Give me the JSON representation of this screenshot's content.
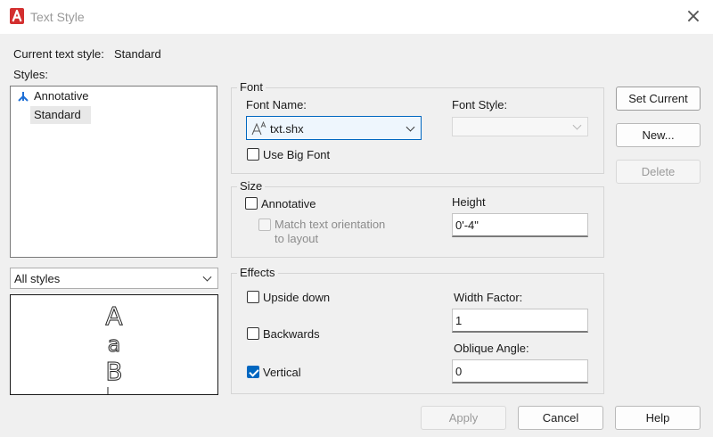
{
  "window": {
    "title": "Text Style",
    "close": "×"
  },
  "current_style": {
    "label": "Current text style:",
    "value": "Standard"
  },
  "styles": {
    "label": "Styles:",
    "items": [
      {
        "label": "Annotative"
      },
      {
        "label": "Standard"
      }
    ],
    "filter_value": "All styles"
  },
  "preview": {
    "glyphs": [
      "A",
      "a",
      "B"
    ]
  },
  "font": {
    "group_title": "Font",
    "font_name_label": "Font Name:",
    "font_name_value": "txt.shx",
    "font_style_label": "Font Style:",
    "font_style_value": "",
    "use_big_font_label": "Use Big Font",
    "use_big_font_checked": false
  },
  "size": {
    "group_title": "Size",
    "annotative_label": "Annotative",
    "annotative_checked": false,
    "match_orientation_label_1": "Match text orientation",
    "match_orientation_label_2": "to layout",
    "height_label": "Height",
    "height_value": "0'-4\""
  },
  "effects": {
    "group_title": "Effects",
    "upside_down_label": "Upside down",
    "upside_down_checked": false,
    "backwards_label": "Backwards",
    "backwards_checked": false,
    "vertical_label": "Vertical",
    "vertical_checked": true,
    "width_factor_label": "Width Factor:",
    "width_factor_value": "1",
    "oblique_angle_label": "Oblique Angle:",
    "oblique_angle_value": "0"
  },
  "buttons": {
    "set_current": "Set Current",
    "new": "New...",
    "delete": "Delete",
    "apply": "Apply",
    "cancel": "Cancel",
    "help": "Help"
  },
  "colors": {
    "accent": "#0067c0",
    "app_icon": "#d32f2f"
  }
}
